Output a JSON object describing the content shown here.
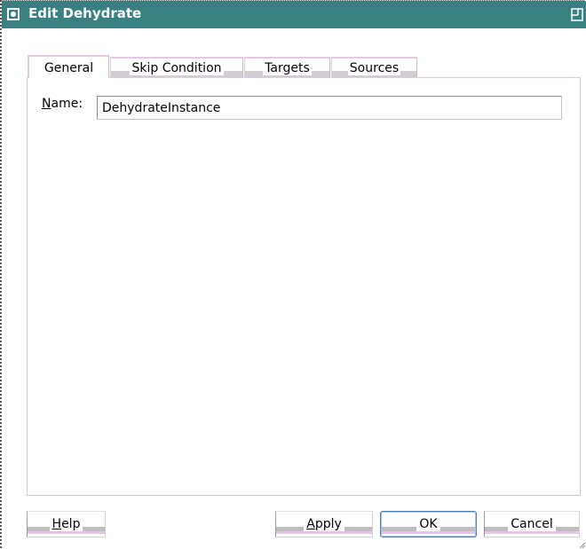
{
  "window": {
    "title": "Edit Dehydrate",
    "titlebar_color": "#3a7f82"
  },
  "tabs": [
    {
      "label": "General",
      "active": true
    },
    {
      "label": "Skip Condition",
      "active": false
    },
    {
      "label": "Targets",
      "active": false
    },
    {
      "label": "Sources",
      "active": false
    }
  ],
  "general": {
    "name_label_mnemonic": "N",
    "name_label_rest": "ame:",
    "name_value": "DehydrateInstance"
  },
  "buttons": {
    "help": {
      "mnemonic": "H",
      "rest": "elp"
    },
    "apply": {
      "mnemonic": "A",
      "rest": "pply"
    },
    "ok": {
      "label": "OK"
    },
    "cancel": {
      "label": "Cancel"
    }
  }
}
